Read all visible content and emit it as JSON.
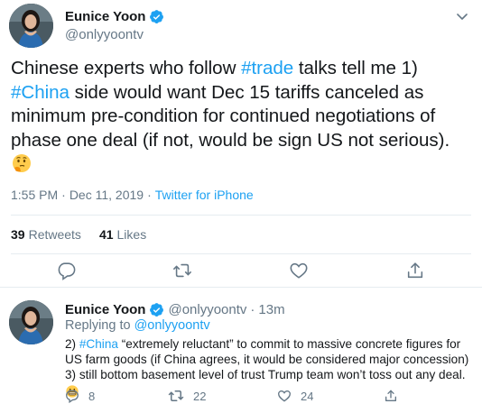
{
  "main_tweet": {
    "display_name": "Eunice Yoon",
    "handle": "@onlyyoontv",
    "text_parts": [
      {
        "type": "text",
        "value": "Chinese experts who follow "
      },
      {
        "type": "hashtag",
        "value": "#trade"
      },
      {
        "type": "text",
        "value": " talks tell me 1) "
      },
      {
        "type": "hashtag",
        "value": "#China"
      },
      {
        "type": "text",
        "value": " side would want Dec 15 tariffs canceled as minimum pre-condition for continued negotiations of phase one deal (if not, would be sign US not serious). "
      }
    ],
    "emoji": "thinking-face-icon",
    "time": "1:55 PM",
    "date": "Dec 11, 2019",
    "separator": "·",
    "source": "Twitter for iPhone",
    "retweets_count": "39",
    "retweets_label": "Retweets",
    "likes_count": "41",
    "likes_label": "Likes"
  },
  "reply_tweet": {
    "display_name": "Eunice Yoon",
    "handle": "@onlyyoontv",
    "separator": "·",
    "time_ago": "13m",
    "replying_prefix": "Replying to",
    "replying_to": "@onlyyoontv",
    "text_parts": [
      {
        "type": "text",
        "value": "2) "
      },
      {
        "type": "hashtag",
        "value": "#China"
      },
      {
        "type": "text",
        "value": " “extremely reluctant” to commit to massive concrete figures for US farm goods (if China agrees, it would be considered major concession) 3) still bottom basement level of trust Trump team won’t toss out any deal. "
      }
    ],
    "emoji": "grimacing-face-icon",
    "reply_count": "8",
    "retweet_count": "22",
    "like_count": "24"
  },
  "colors": {
    "accent": "#1da1f2",
    "text": "#14171a",
    "secondary": "#657786",
    "divider": "#e6ecf0"
  }
}
